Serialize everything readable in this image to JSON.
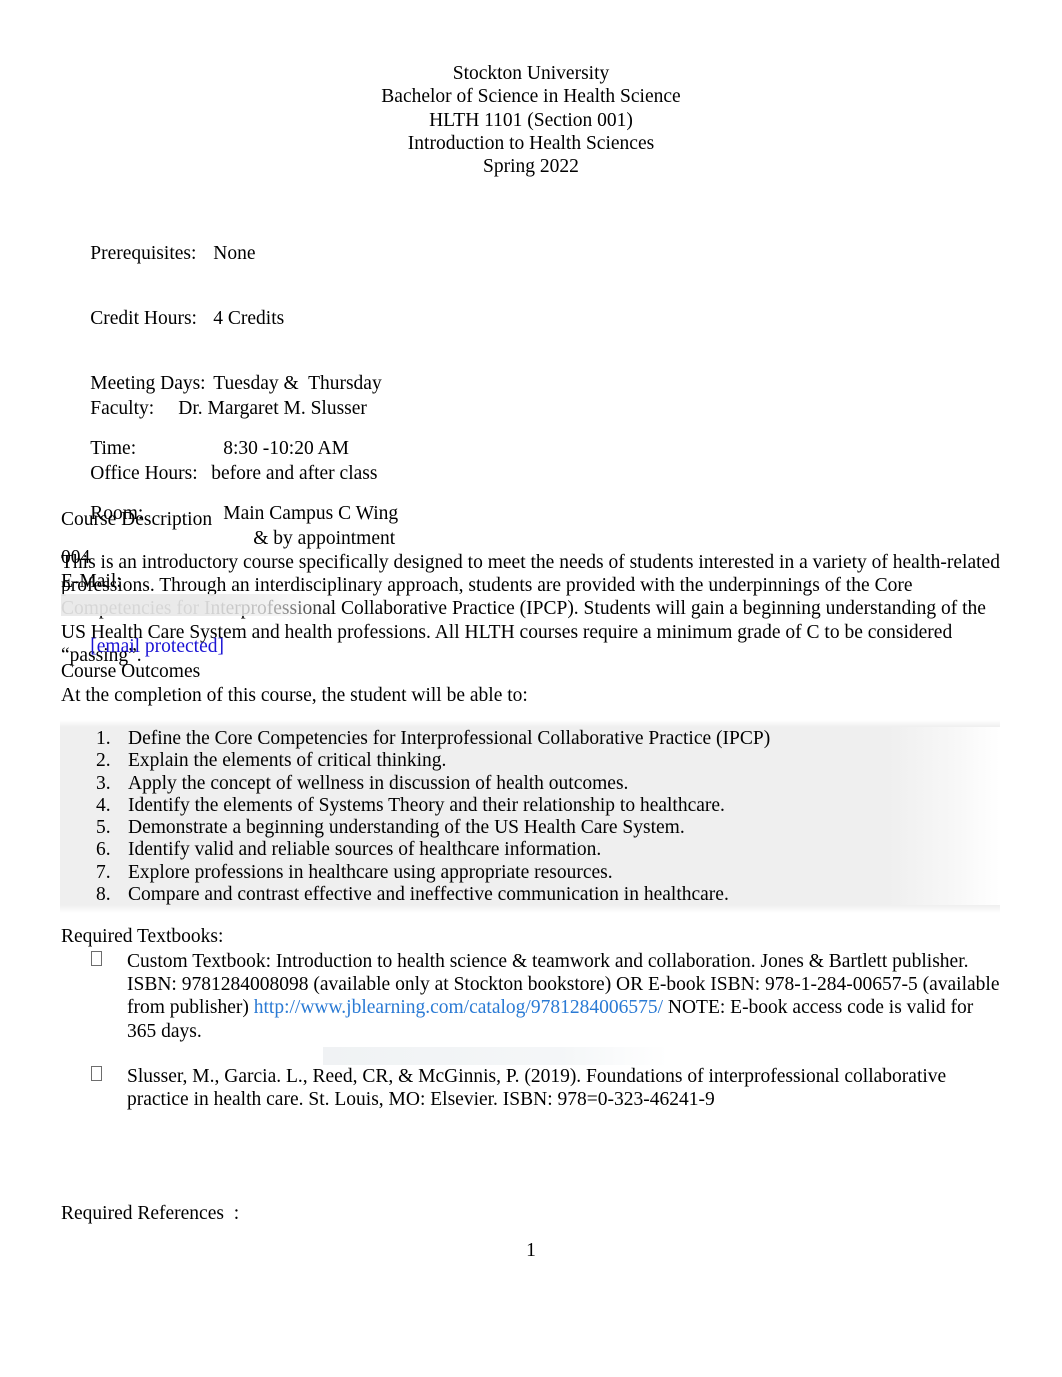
{
  "document": {
    "header_lines": [
      "Stockton University",
      "Bachelor of Science in Health Science",
      "HLTH 1101 (Section 001)",
      "Introduction to Health Sciences",
      "Spring 2022"
    ],
    "page_number": "1"
  },
  "course_info": {
    "rows": [
      {
        "label": "Prerequisites:",
        "value": "None"
      },
      {
        "label": "Credit Hours:",
        "value": "4 Credits"
      },
      {
        "label": "Meeting Days:",
        "value": "Tuesday &  Thursday"
      },
      {
        "label": "Time:",
        "value": "8:30 -10:20 AM"
      },
      {
        "label": "Room:",
        "value": "Main Campus C Wing"
      }
    ],
    "room_continuation": "004"
  },
  "faculty_info": {
    "faculty_label": "Faculty:",
    "faculty_value": "Dr. Margaret M. Slusser",
    "office_hours_label": "Office Hours:",
    "office_hours_value": "before and after class",
    "office_hours_continuation": "& by appointment",
    "email_label": "E-Mail:",
    "email_value": "[email protected]"
  },
  "course_description": {
    "heading": "Course Description",
    "body": "This is an introductory course specifically designed to meet the needs of students interested in a variety of health-related professions. Through an interdisciplinary approach, students are provided with the underpinnings of the Core Competencies for Interprofessional Collaborative Practice (IPCP). Students will gain a beginning understanding of the US Health Care System and health professions.  All HLTH courses require a minimum grade of C to be considered “passing”."
  },
  "course_outcomes": {
    "heading": "Course Outcomes",
    "intro": "At the completion of this course, the student will be able to:",
    "items": [
      {
        "num": "1.",
        "text": "Define the Core Competencies for Interprofessional Collaborative Practice (IPCP)"
      },
      {
        "num": "2.",
        "text": "Explain the elements of critical thinking."
      },
      {
        "num": "3.",
        "text": "Apply the concept of wellness in discussion of health outcomes."
      },
      {
        "num": "4.",
        "text": "Identify the elements of Systems Theory and their relationship to healthcare."
      },
      {
        "num": "5.",
        "text": "Demonstrate a beginning understanding of the US Health Care System."
      },
      {
        "num": "6.",
        "text": "Identify valid and reliable sources of healthcare information."
      },
      {
        "num": "7.",
        "text": "Explore professions in healthcare using appropriate resources."
      },
      {
        "num": "8.",
        "text": "Compare and contrast effective and ineffective communication in healthcare."
      }
    ]
  },
  "required_textbooks": {
    "heading": "Required Textbooks:",
    "item1_part1": "Custom Textbook: Introduction to health science & teamwork and collaboration.  Jones & Bartlett publisher. ISBN: 9781284008098 (available only at Stockton bookstore) OR E-book ISBN: 978-1-284-00657-5 (available from publisher) ",
    "item1_url": "http://www.jblearning.com/catalog/9781284006575/",
    "item1_part2": "  NOTE: E-book access code is valid for 365 days.",
    "item2": "Slusser, M., Garcia. L., Reed, CR, & McGinnis, P. (2019).  Foundations of interprofessional collaborative practice in health care.  St. Louis, MO: Elsevier.   ISBN: 978=0-323-46241-9"
  },
  "required_references": {
    "heading": "Required References  :"
  },
  "colors": {
    "email_link": "#1a13d4",
    "url_link": "#2a7ad4",
    "highlight_wash": "#eeeeee",
    "text": "#000000"
  }
}
